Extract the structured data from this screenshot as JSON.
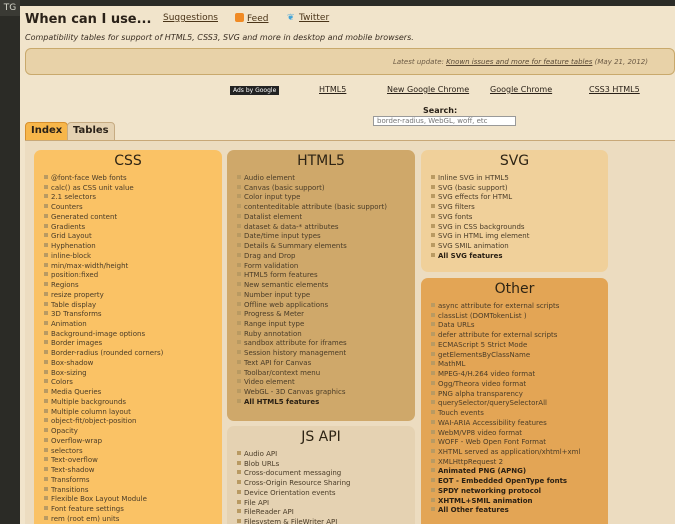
{
  "corner_tag": "TG",
  "header": {
    "title": "When can I use...",
    "links": {
      "suggestions": "Suggestions",
      "feed": "Feed",
      "twitter": "Twitter"
    },
    "subtitle": "Compatibility tables for support of HTML5, CSS3, SVG and more in desktop and mobile browsers."
  },
  "update": {
    "prefix": "Latest update: ",
    "link": "Known issues and more for feature tables",
    "suffix": " (May 21, 2012)"
  },
  "ads": {
    "badge": "Ads by Google",
    "links": [
      "HTML5",
      "New Google Chrome",
      "Google Chrome",
      "CSS3 HTML5"
    ]
  },
  "search": {
    "label": "Search:",
    "placeholder": "border-radius, WebGL, woff, etc"
  },
  "tabs": {
    "index": "Index",
    "tables": "Tables"
  },
  "boxes": {
    "css": {
      "title": "CSS",
      "items": [
        "@font-face Web fonts",
        "calc() as CSS unit value",
        "2.1 selectors",
        "Counters",
        "Generated content",
        "Gradients",
        "Grid Layout",
        "Hyphenation",
        "inline-block",
        "min/max-width/height",
        "position:fixed",
        "Regions",
        "resize property",
        "Table display",
        "3D Transforms",
        "Animation",
        "Background-image options",
        "Border images",
        "Border-radius (rounded corners)",
        "Box-shadow",
        "Box-sizing",
        "Colors",
        "Media Queries",
        "Multiple backgrounds",
        "Multiple column layout",
        "object-fit/object-position",
        "Opacity",
        "Overflow-wrap",
        "selectors",
        "Text-overflow",
        "Text-shadow",
        "Transforms",
        "Transitions",
        "Flexible Box Layout Module",
        "Font feature settings",
        "rem (root em) units"
      ]
    },
    "html5": {
      "title": "HTML5",
      "items": [
        "Audio element",
        "Canvas (basic support)",
        "Color input type",
        "contenteditable attribute (basic support)",
        "Datalist element",
        "dataset & data-* attributes",
        "Date/time input types",
        "Details & Summary elements",
        "Drag and Drop",
        "Form validation",
        "HTML5 form features",
        "New semantic elements",
        "Number input type",
        "Offline web applications",
        "Progress & Meter",
        "Range input type",
        "Ruby annotation",
        "sandbox attribute for iframes",
        "Session history management",
        "Text API for Canvas",
        "Toolbar/context menu",
        "Video element",
        "WebGL - 3D Canvas graphics"
      ],
      "all_label": "All HTML5 features"
    },
    "jsapi": {
      "title": "JS API",
      "items": [
        "Audio API",
        "Blob URLs",
        "Cross-document messaging",
        "Cross-Origin Resource Sharing",
        "Device Orientation events",
        "File API",
        "FileReader API",
        "Filesystem & FileWriter API"
      ]
    },
    "svg": {
      "title": "SVG",
      "items": [
        "Inline SVG in HTML5",
        "SVG (basic support)",
        "SVG effects for HTML",
        "SVG filters",
        "SVG fonts",
        "SVG in CSS backgrounds",
        "SVG in HTML img element",
        "SVG SMIL animation"
      ],
      "all_label": "All SVG features"
    },
    "other": {
      "title": "Other",
      "items": [
        "async attribute for external scripts",
        "classList (DOMTokenList )",
        "Data URLs",
        "defer attribute for external scripts",
        "ECMAScript 5 Strict Mode",
        "getElementsByClassName",
        "MathML",
        "MPEG-4/H.264 video format",
        "Ogg/Theora video format",
        "PNG alpha transparency",
        "querySelector/querySelectorAll",
        "Touch events",
        "WAI-ARIA Accessibility features",
        "WebM/VP8 video format",
        "WOFF - Web Open Font Format",
        "XHTML served as application/xhtml+xml",
        "XMLHttpRequest 2"
      ],
      "strong_items": [
        "Animated PNG (APNG)",
        "EOT - Embedded OpenType fonts",
        "SPDY networking protocol",
        "XHTML+SMIL animation"
      ],
      "all_label": "All Other features"
    }
  }
}
